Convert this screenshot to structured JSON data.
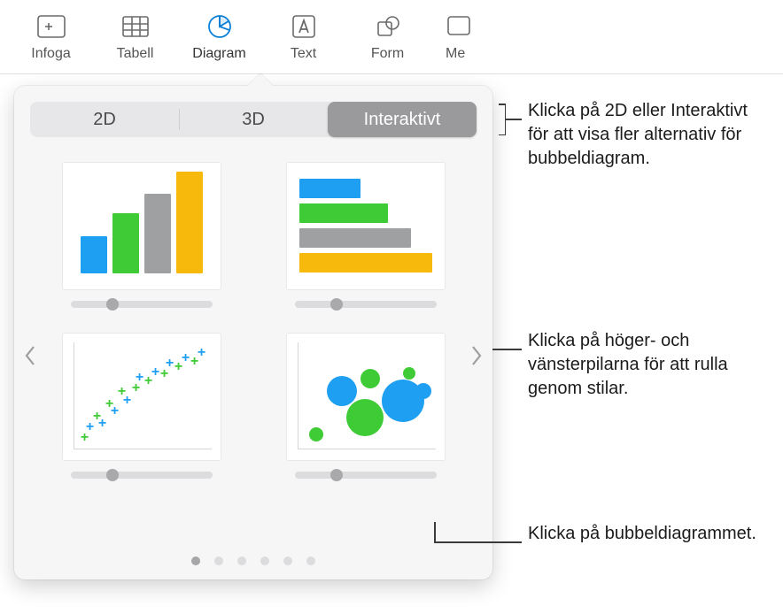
{
  "toolbar": {
    "items": [
      {
        "label": "Infoga",
        "icon": "insert"
      },
      {
        "label": "Tabell",
        "icon": "table"
      },
      {
        "label": "Diagram",
        "icon": "chart",
        "active": true
      },
      {
        "label": "Text",
        "icon": "text"
      },
      {
        "label": "Form",
        "icon": "shape"
      },
      {
        "label": "Me",
        "icon": "media"
      }
    ]
  },
  "popover": {
    "tabs": {
      "t2d": "2D",
      "t3d": "3D",
      "interactive": "Interaktivt"
    },
    "selected_tab": "interactive",
    "page_count": 6,
    "active_page": 0
  },
  "callouts": {
    "tabs": "Klicka på 2D eller Interaktivt för att visa fler alternativ för bubbeldiagram.",
    "arrows": "Klicka på höger- och vänsterpilarna för att rulla genom stilar.",
    "bubble": "Klicka på bubbeldiagrammet."
  }
}
